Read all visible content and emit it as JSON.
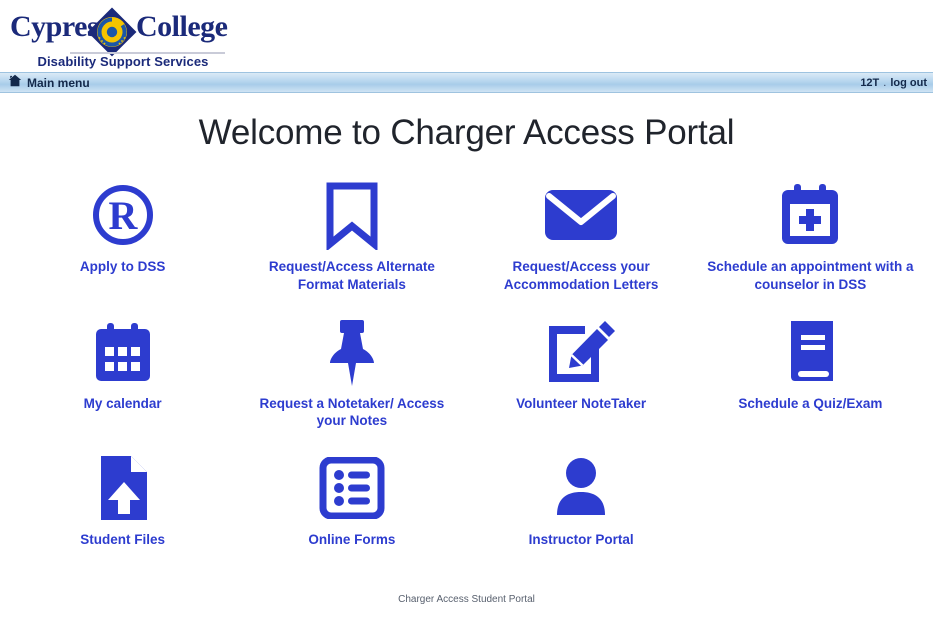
{
  "brand": {
    "word_one": "Cypress",
    "word_two": "College",
    "tagline": "Disability Support Services",
    "logo_icon": "cypress-college-diamond-logo"
  },
  "nav": {
    "home_icon": "home-icon",
    "main_menu_label": "Main menu",
    "user_code": "12T",
    "separator": ".",
    "logout_label": "log out"
  },
  "page": {
    "title": "Welcome to Charger Access Portal"
  },
  "tiles": [
    {
      "label": "Apply to DSS",
      "icon": "registered-trademark-icon",
      "name": "tile-apply-to-dss"
    },
    {
      "label": "Request/Access Alternate Format Materials",
      "icon": "bookmark-icon",
      "name": "tile-alternate-format-materials"
    },
    {
      "label": "Request/Access your Accommodation Letters",
      "icon": "envelope-icon",
      "name": "tile-accommodation-letters"
    },
    {
      "label": "Schedule an appointment with a counselor in DSS",
      "icon": "calendar-plus-icon",
      "name": "tile-schedule-appointment"
    },
    {
      "label": "My calendar",
      "icon": "calendar-icon",
      "name": "tile-my-calendar"
    },
    {
      "label": "Request a Notetaker/ Access your Notes",
      "icon": "pushpin-icon",
      "name": "tile-request-notetaker"
    },
    {
      "label": "Volunteer NoteTaker",
      "icon": "pencil-square-icon",
      "name": "tile-volunteer-notetaker"
    },
    {
      "label": "Schedule a Quiz/Exam",
      "icon": "book-icon",
      "name": "tile-schedule-quiz-exam"
    },
    {
      "label": "Student Files",
      "icon": "file-upload-icon",
      "name": "tile-student-files"
    },
    {
      "label": "Online Forms",
      "icon": "form-list-icon",
      "name": "tile-online-forms"
    },
    {
      "label": "Instructor Portal",
      "icon": "person-icon",
      "name": "tile-instructor-portal"
    }
  ],
  "footer": {
    "text": "Charger Access Student Portal"
  },
  "colors": {
    "tile_blue": "#2d3ccf",
    "brand_navy": "#1b2a7a",
    "logo_gold": "#f5c400",
    "navbar_blue": "#b8d6ef"
  }
}
